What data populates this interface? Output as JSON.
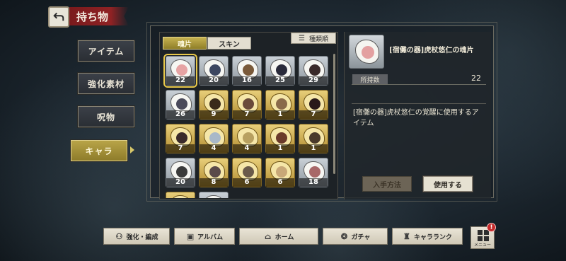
{
  "header": {
    "title": "持ち物"
  },
  "side_tabs": [
    {
      "label": "アイテム",
      "active": false
    },
    {
      "label": "強化素材",
      "active": false
    },
    {
      "label": "呪物",
      "active": false
    },
    {
      "label": "キャラ",
      "active": true
    }
  ],
  "top_tabs": [
    {
      "label": "魂片",
      "active": true
    },
    {
      "label": "スキン",
      "active": false
    }
  ],
  "sort_button": {
    "label": "種類順"
  },
  "items": [
    {
      "frame": "grey",
      "count": "22",
      "selected": true,
      "face": "#e6a3a3"
    },
    {
      "frame": "grey",
      "count": "20",
      "face": "#3c4660"
    },
    {
      "frame": "grey",
      "count": "16",
      "face": "#7a5a3a"
    },
    {
      "frame": "grey",
      "count": "25",
      "face": "#2a2a3a"
    },
    {
      "frame": "grey",
      "count": "29",
      "face": "#3a2a2a"
    },
    {
      "frame": "grey",
      "count": "26",
      "face": "#4a4a5a"
    },
    {
      "frame": "gold",
      "count": "9",
      "face": "#3a2a1a"
    },
    {
      "frame": "gold",
      "count": "7",
      "face": "#6a4a3a"
    },
    {
      "frame": "gold",
      "count": "1",
      "face": "#8a6a4a"
    },
    {
      "frame": "gold",
      "count": "7",
      "face": "#2a1a1a"
    },
    {
      "frame": "gold",
      "count": "7",
      "face": "#3a2a2a"
    },
    {
      "frame": "gold",
      "count": "4",
      "face": "#a8b8c8"
    },
    {
      "frame": "gold",
      "count": "4",
      "face": "#b8a060"
    },
    {
      "frame": "gold",
      "count": "1",
      "face": "#6a3a2a"
    },
    {
      "frame": "gold",
      "count": "1",
      "face": "#4a3a2a"
    },
    {
      "frame": "grey",
      "count": "20",
      "face": "#3a3a3a"
    },
    {
      "frame": "gold",
      "count": "8",
      "face": "#5a4a4a"
    },
    {
      "frame": "gold",
      "count": "6",
      "face": "#6a5a4a"
    },
    {
      "frame": "gold",
      "count": "6",
      "face": "#c8a878"
    },
    {
      "frame": "grey",
      "count": "18",
      "face": "#a86868"
    },
    {
      "frame": "gold",
      "count": "",
      "face": "#c0a050"
    },
    {
      "frame": "grey",
      "count": "",
      "face": "#9aa4ac"
    }
  ],
  "detail": {
    "name": "[宿儺の器]虎杖悠仁の魂片",
    "owned_label": "所持数",
    "owned_count": "22",
    "description": "[宿儺の器]虎杖悠仁の覚醒に使用するアイテム",
    "obtain_button": "入手方法",
    "use_button": "使用する"
  },
  "bottom_nav": [
    {
      "label": "強化・編成",
      "icon": "enhance-icon"
    },
    {
      "label": "アルバム",
      "icon": "album-icon"
    },
    {
      "label": "ホーム",
      "icon": "home-icon"
    },
    {
      "label": "ガチャ",
      "icon": "gacha-icon"
    },
    {
      "label": "キャラランク",
      "icon": "rank-icon"
    }
  ],
  "menu": {
    "label": "メニュー",
    "badge": "!"
  }
}
